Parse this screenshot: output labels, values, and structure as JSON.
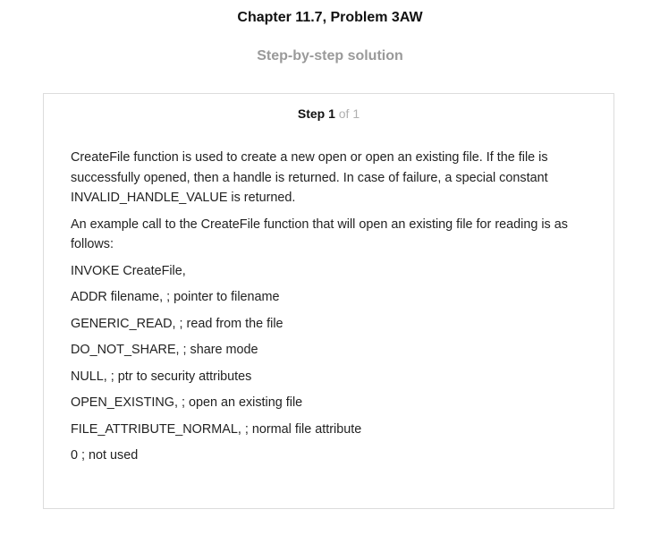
{
  "header": {
    "title": "Chapter 11.7, Problem 3AW",
    "subtitle": "Step-by-step solution"
  },
  "step": {
    "label": "Step 1",
    "of_text": "of 1"
  },
  "content": {
    "paragraphs": [
      "CreateFile function is used to create a new open or open an existing file. If the file is successfully opened, then a handle is returned. In case of failure, a special constant INVALID_HANDLE_VALUE is returned.",
      "An example call to the CreateFile function that will open an existing file for reading is as follows:",
      "INVOKE CreateFile,",
      "ADDR filename, ; pointer to filename",
      "GENERIC_READ, ; read from the file",
      "DO_NOT_SHARE, ; share mode",
      "NULL, ; ptr to security attributes",
      "OPEN_EXISTING, ; open an existing file",
      "FILE_ATTRIBUTE_NORMAL, ; normal file attribute",
      "0 ; not used"
    ]
  }
}
